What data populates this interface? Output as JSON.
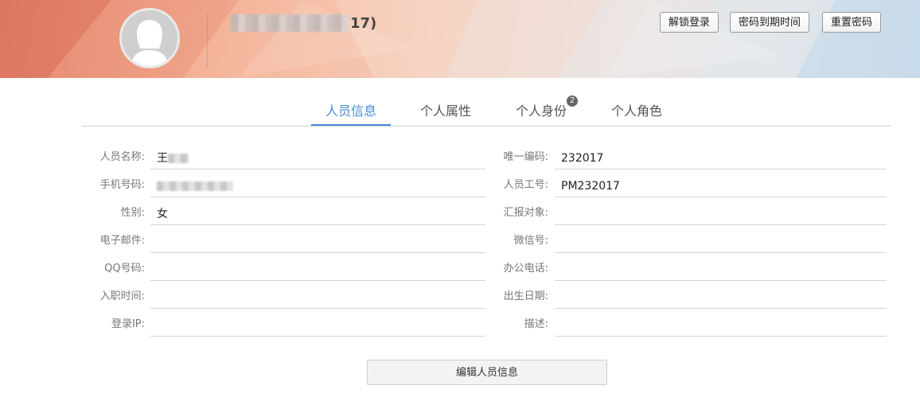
{
  "header": {
    "user_name_suffix": "17)",
    "buttons": {
      "unlock": "解锁登录",
      "password_expiry": "密码到期时间",
      "reset_password": "重置密码"
    }
  },
  "tabs": [
    {
      "label": "人员信息",
      "active": true
    },
    {
      "label": "个人属性"
    },
    {
      "label": "个人身份",
      "badge": "2"
    },
    {
      "label": "个人角色"
    }
  ],
  "form": {
    "left": [
      {
        "label": "人员名称:",
        "value": "王"
      },
      {
        "label": "手机号码:",
        "value": ""
      },
      {
        "label": "性别:",
        "value": "女"
      },
      {
        "label": "电子邮件:",
        "value": ""
      },
      {
        "label": "QQ号码:",
        "value": ""
      },
      {
        "label": "入职时间:",
        "value": ""
      },
      {
        "label": "登录IP:",
        "value": ""
      }
    ],
    "right": [
      {
        "label": "唯一编码:",
        "value": "232017"
      },
      {
        "label": "人员工号:",
        "value": "PM232017"
      },
      {
        "label": "汇报对象:",
        "value": ""
      },
      {
        "label": "微信号:",
        "value": ""
      },
      {
        "label": "办公电话:",
        "value": ""
      },
      {
        "label": "出生日期:",
        "value": ""
      },
      {
        "label": "描述:",
        "value": ""
      }
    ]
  },
  "actions": {
    "edit_label": "编辑人员信息"
  },
  "icons": {
    "avatar": "female-user-avatar-icon"
  },
  "colors": {
    "accent": "#4a8bd6",
    "badge": "#666666"
  }
}
